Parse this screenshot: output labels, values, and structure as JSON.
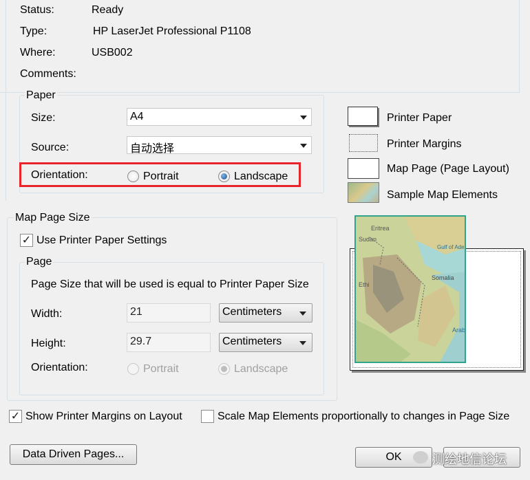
{
  "printer": {
    "status_label": "Status:",
    "status_value": "Ready",
    "type_label": "Type:",
    "type_value": "HP LaserJet Professional P1108",
    "where_label": "Where:",
    "where_value": "USB002",
    "comments_label": "Comments:"
  },
  "paper": {
    "title": "Paper",
    "size_label": "Size:",
    "size_value": "A4",
    "source_label": "Source:",
    "source_value": "自动选择",
    "orientation_label": "Orientation:",
    "portrait_label": "Portrait",
    "landscape_label": "Landscape",
    "selected_orientation": "Landscape"
  },
  "legend": {
    "printer_paper": "Printer Paper",
    "printer_margins": "Printer Margins",
    "map_page": "Map Page (Page Layout)",
    "sample_map": "Sample Map Elements"
  },
  "map_preview": {
    "labels": [
      "Eritrea",
      "Sudan",
      "Ethi",
      "Somalia",
      "Gulf of Aden",
      "Arabi"
    ]
  },
  "map_page_size": {
    "title": "Map Page Size",
    "use_printer_settings_label": "Use Printer Paper Settings",
    "use_printer_settings_checked": true,
    "page": {
      "title": "Page",
      "info": "Page Size that will be used is equal to Printer Paper Size",
      "width_label": "Width:",
      "width_value": "21",
      "width_unit": "Centimeters",
      "height_label": "Height:",
      "height_value": "29.7",
      "height_unit": "Centimeters",
      "orientation_label": "Orientation:",
      "portrait_label": "Portrait",
      "landscape_label": "Landscape"
    }
  },
  "bottom": {
    "show_margins_label": "Show Printer Margins on Layout",
    "show_margins_checked": true,
    "scale_label": "Scale Map Elements proportionally to changes in Page Size",
    "scale_checked": false,
    "data_driven_button": "Data Driven Pages...",
    "ok_button": "OK",
    "watermark": "测绘地信论坛"
  },
  "colors": {
    "highlight": "#e8232a",
    "map_border": "#2ea58a"
  }
}
